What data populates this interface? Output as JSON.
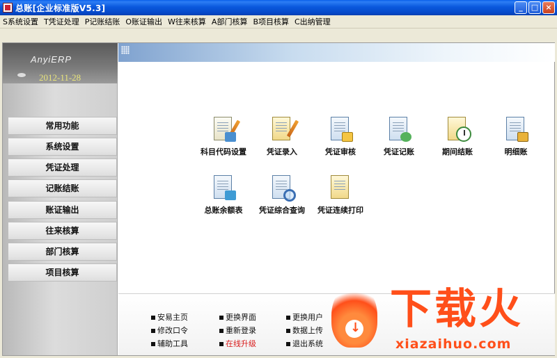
{
  "window": {
    "title": "总账[企业标准版V5.3]",
    "controls": [
      "_",
      "□",
      "×"
    ]
  },
  "menu": [
    "S系统设置",
    "T凭证处理",
    "P记账结账",
    "O账证输出",
    "W往来核算",
    "A部门核算",
    "B项目核算",
    "C出纳管理"
  ],
  "brand": {
    "logo": "AnyiERP",
    "date": "2012-11-28"
  },
  "nav": [
    "常用功能",
    "系统设置",
    "凭证处理",
    "记账结账",
    "账证输出",
    "往来核算",
    "部门核算",
    "项目核算"
  ],
  "functions": [
    "科目代码设置",
    "凭证录入",
    "凭证审核",
    "凭证记账",
    "期间结账",
    "明细账",
    "总账余额表",
    "凭证综合查询",
    "凭证连续打印"
  ],
  "links": [
    "安易主页",
    "更换界面",
    "更换用户",
    "修改口令",
    "重新登录",
    "数据上传",
    "辅助工具",
    "在线升级",
    "退出系统"
  ],
  "watermark": {
    "cn": "下载火",
    "en": "xiazaihuo.com"
  },
  "colors": {
    "title_bar": "#0A58DD",
    "link_alert": "#D81B1B",
    "watermark": "#FF4F1A"
  }
}
